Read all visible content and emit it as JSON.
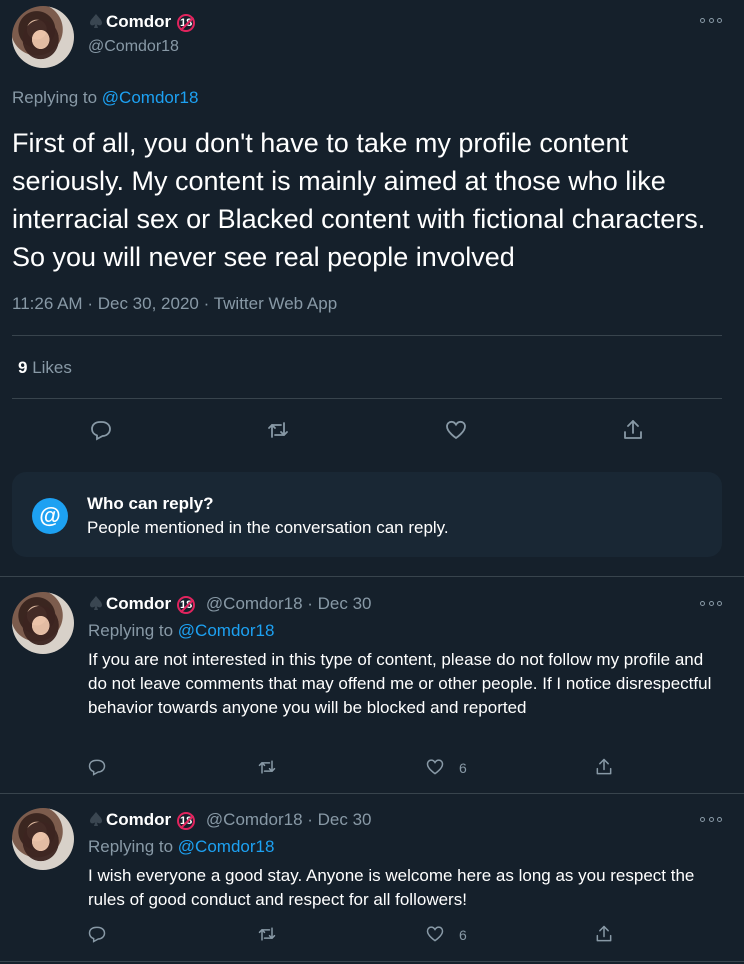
{
  "main_tweet": {
    "display_name": "Comdor",
    "badge": "18",
    "handle": "@Comdor18",
    "replying_label": "Replying to",
    "replying_handle": "@Comdor18",
    "text": "First of all, you don't have to take my profile content seriously. My content is mainly aimed at those who like interracial sex or Blacked content with fictional characters. So you will never see real people involved",
    "time": "11:26 AM",
    "sep1": "·",
    "date": "Dec 30, 2020",
    "sep2": "·",
    "client": "Twitter Web App",
    "likes_count": "9",
    "likes_label": "Likes"
  },
  "who_can_reply": {
    "title": "Who can reply?",
    "description": "People mentioned in the conversation can reply.",
    "icon_glyph": "@"
  },
  "replies": [
    {
      "display_name": "Comdor",
      "badge": "18",
      "handle_date": "@Comdor18 · Dec 30",
      "replying_label": "Replying to",
      "replying_handle": "@Comdor18",
      "text": "If you are not interested in this type of content, please do not follow my profile and do not leave comments that may offend me or other people. If I notice disrespectful behavior towards anyone you will be blocked and reported",
      "like_count": "6"
    },
    {
      "display_name": "Comdor",
      "badge": "18",
      "handle_date": "@Comdor18 · Dec 30",
      "replying_label": "Replying to",
      "replying_handle": "@Comdor18",
      "text": "I wish everyone a good stay. Anyone is welcome here as long as you respect the rules of good conduct and respect for all followers!",
      "like_count": "6"
    }
  ],
  "colors": {
    "background": "#15202b",
    "accent": "#1da1f2",
    "muted": "#8899a6",
    "divider": "#38444d",
    "badge": "#e0245e"
  },
  "icons": [
    "spade-icon",
    "age-18-icon",
    "more-icon",
    "reply-icon",
    "retweet-icon",
    "like-icon",
    "share-icon",
    "at-icon"
  ]
}
